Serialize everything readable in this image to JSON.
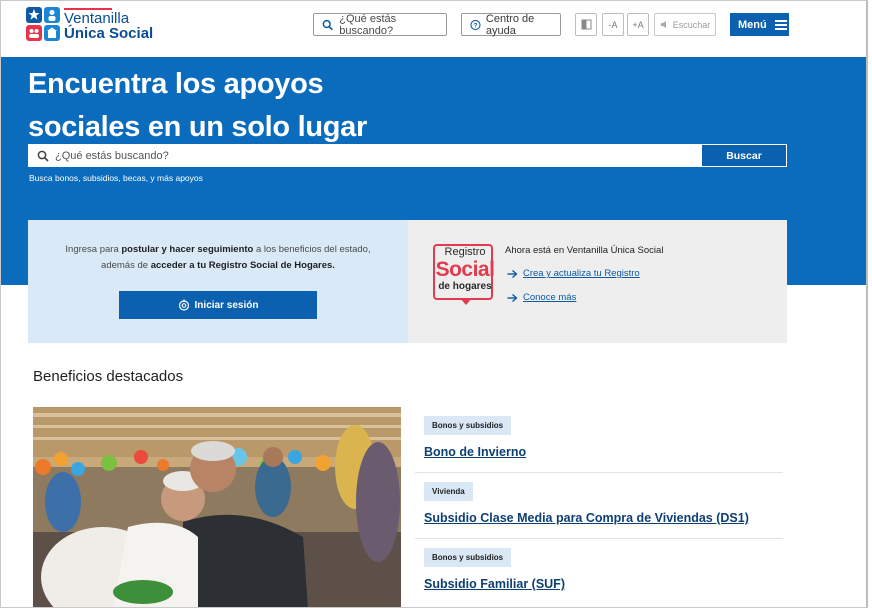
{
  "header": {
    "logo_line1": "Ventanilla",
    "logo_line2": "Única Social",
    "search_placeholder": "¿Qué estás buscando?",
    "help_label": "Centro de ayuda",
    "contrast_icon": "contrast-icon",
    "font_decrease_label": "-A",
    "font_increase_label": "+A",
    "listen_label": "Escuchar",
    "menu_label": "Menú"
  },
  "hero": {
    "title_line1": "Encuentra los apoyos",
    "title_line2": "sociales en un solo lugar",
    "search_placeholder": "¿Qué estás buscando?",
    "search_button": "Buscar",
    "hint": "Busca bonos, subsidios, becas, y más apoyos"
  },
  "login_card": {
    "text_1": "Ingresa para ",
    "text_bold_1": "postular y hacer seguimiento",
    "text_2": " a los beneficios del estado, además de ",
    "text_bold_2": "acceder a tu Registro Social de Hogares.",
    "button": "Iniciar sesión"
  },
  "rsh_card": {
    "logo_line1": "Registro",
    "logo_line2": "Social",
    "logo_line3": "de hogares",
    "heading": "Ahora está en Ventanilla Única Social",
    "link1": "Crea y actualiza tu Registro",
    "link2": "Conoce más"
  },
  "featured": {
    "title": "Beneficios destacados",
    "items": [
      {
        "tag": "Bonos y subsidios",
        "name": "Bono de Invierno"
      },
      {
        "tag": "Vivienda",
        "name": "Subsidio Clase Media para Compra de Viviendas (DS1)"
      },
      {
        "tag": "Bonos y subsidios",
        "name": "Subsidio Familiar (SUF)"
      }
    ]
  },
  "colors": {
    "primary_blue": "#0b6cbe",
    "button_blue": "#0b60b0",
    "light_blue": "#dae9f7",
    "rsh_red": "#e23b4d"
  }
}
